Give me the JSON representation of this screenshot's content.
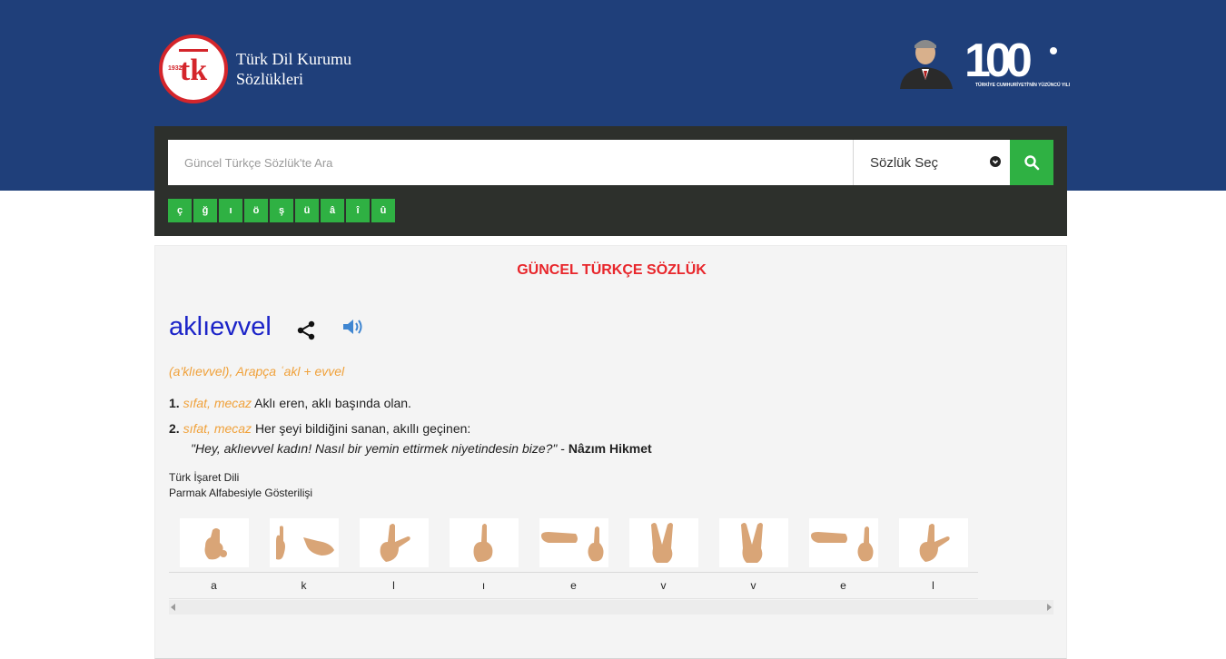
{
  "header": {
    "brand_line1": "Türk Dil Kurumu",
    "brand_line2": "Sözlükleri",
    "logo_year": "1932",
    "logo_letters": "tdk",
    "anniversary_number": "100",
    "anniversary_caption": "TÜRKİYE CUMHURİYETİ'NİN YÜZÜNCÜ YILI",
    "brand_color": "#1f3f7a"
  },
  "search": {
    "placeholder": "Güncel Türkçe Sözlük'te Ara",
    "value": "",
    "dictionary_select": "Sözlük Seç",
    "button_icon": "search-icon",
    "special_letters": [
      "ç",
      "ğ",
      "ı",
      "ö",
      "ş",
      "ü",
      "â",
      "î",
      "û"
    ],
    "accent_color": "#2fb143"
  },
  "entry": {
    "dictionary_title": "GÜNCEL TÜRKÇE SÖZLÜK",
    "word": "aklıevvel",
    "share_icon": "share-icon",
    "audio_icon": "speaker-icon",
    "origin": "(a'klıevvel), Arapça ʿakl + evvel",
    "meanings": [
      {
        "number": "1.",
        "tags": "sıfat, mecaz",
        "text": "Aklı eren, aklı başında olan."
      },
      {
        "number": "2.",
        "tags": "sıfat, mecaz",
        "text": "Her şeyi bildiğini sanan, akıllı geçinen:"
      }
    ],
    "example": {
      "quote": "\"Hey, aklıevvel kadın! Nasıl bir yemin ettirmek niyetindesin bize?\"",
      "separator": "-",
      "author": "Nâzım Hikmet"
    }
  },
  "sign_language": {
    "title_line1": "Türk İşaret Dili",
    "title_line2": "Parmak Alfabesiyle Gösterilişi",
    "letters": [
      "a",
      "k",
      "l",
      "ı",
      "e",
      "v",
      "v",
      "e",
      "l"
    ]
  }
}
